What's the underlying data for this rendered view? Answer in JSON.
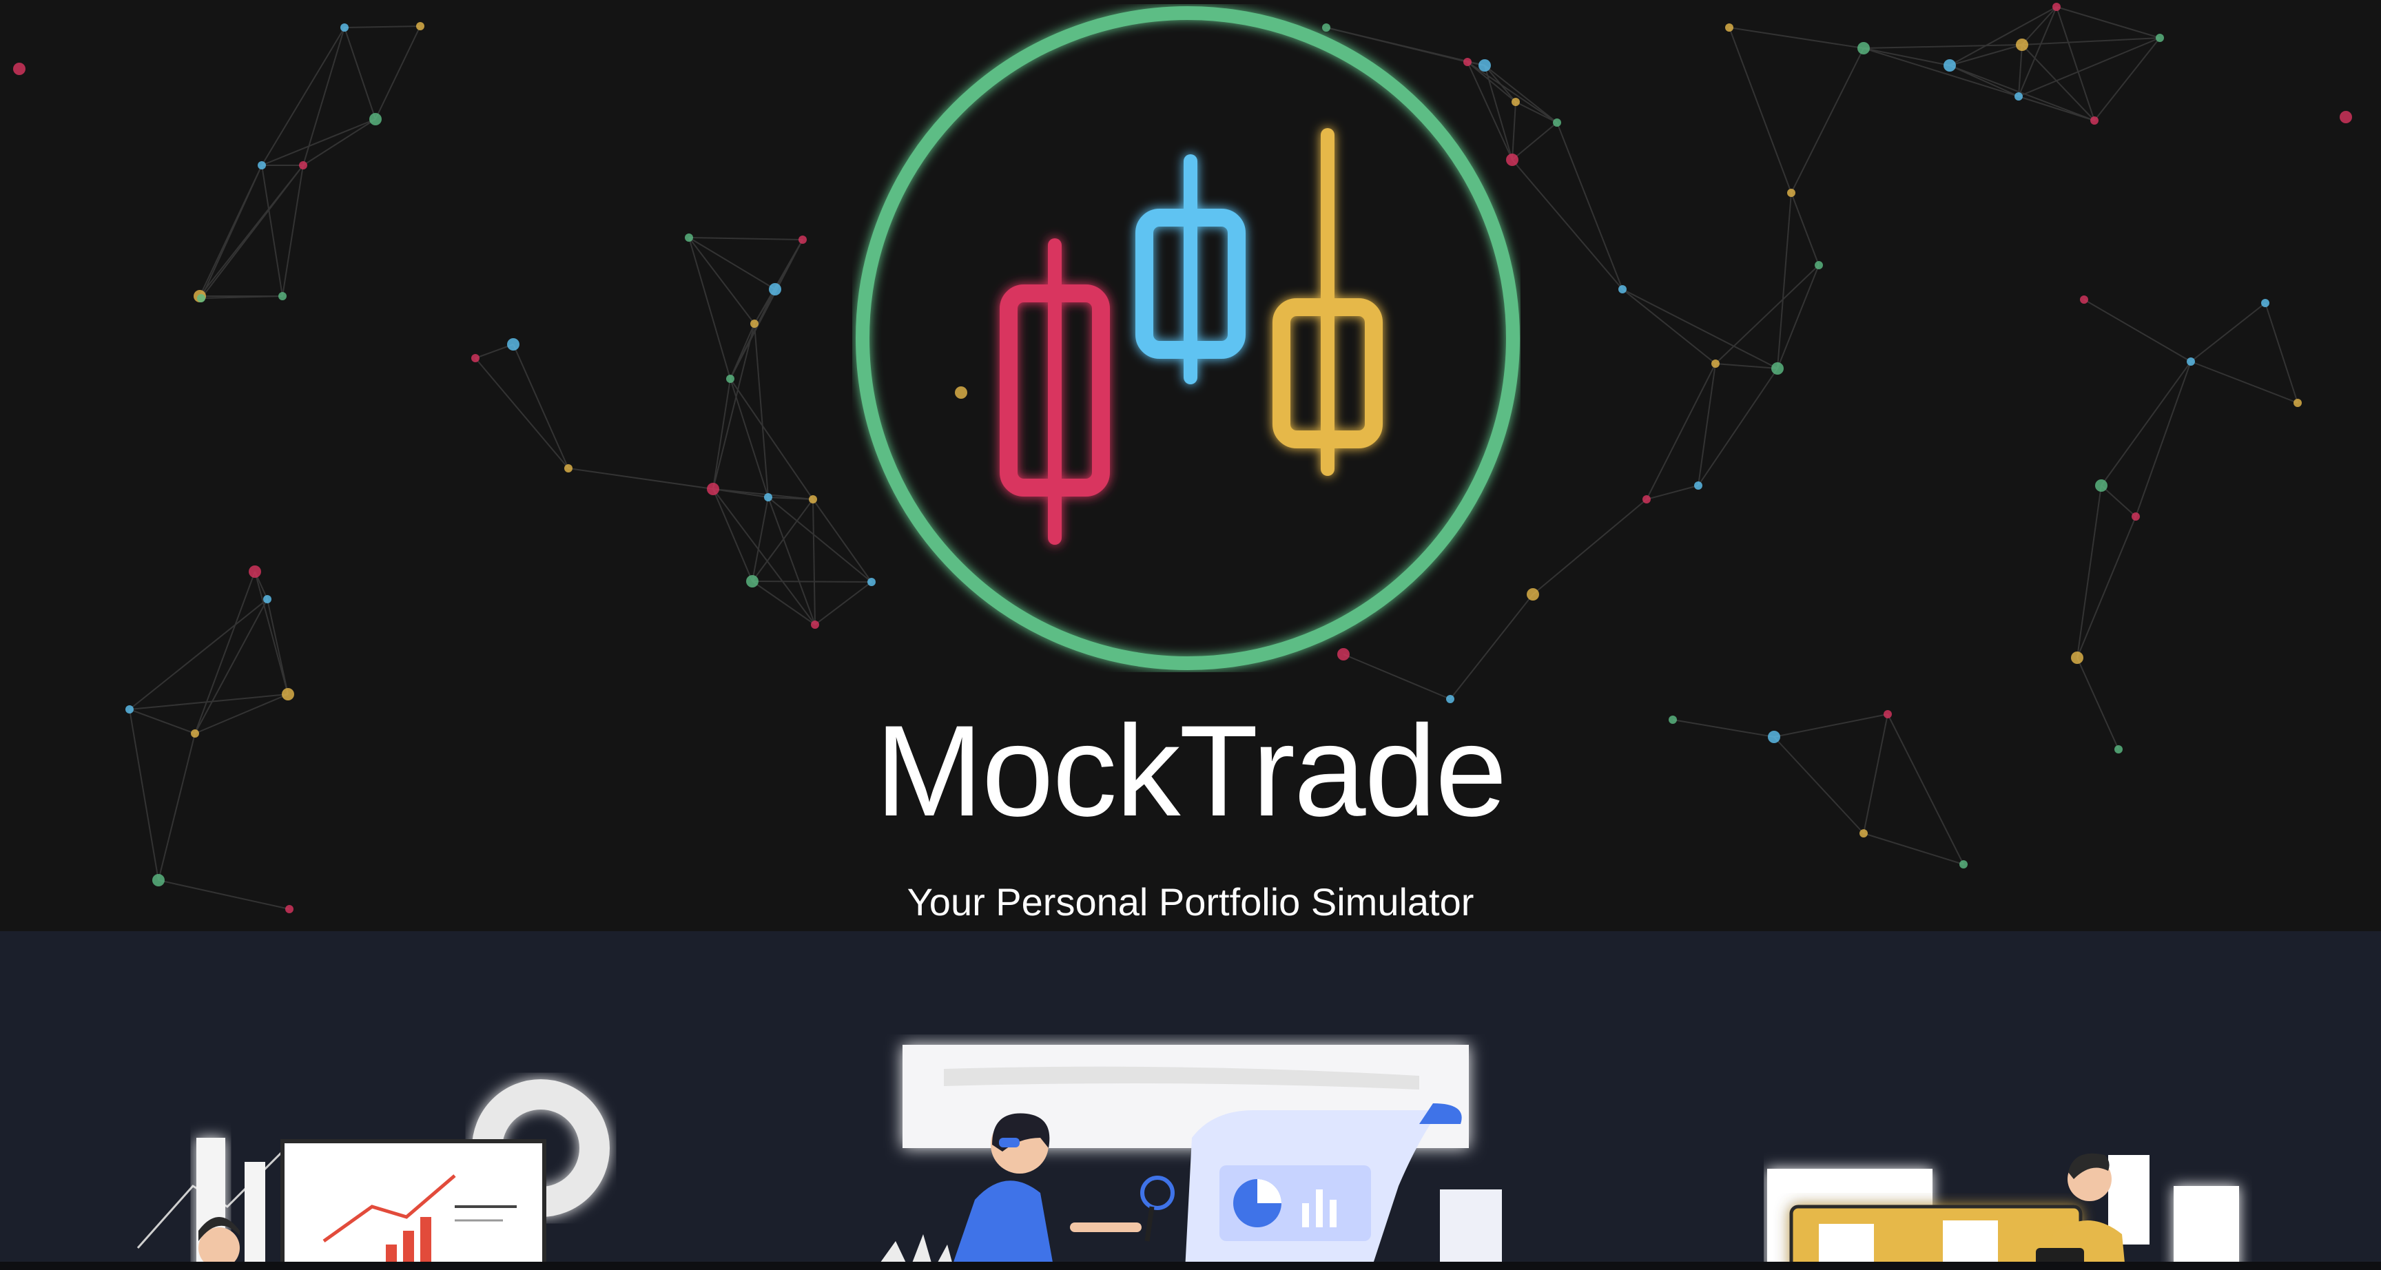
{
  "brand": {
    "title": "MockTrade",
    "subtitle": "Your Personal Portfolio Simulator",
    "logo_icon": "candlestick-chart-icon"
  },
  "colors": {
    "hero_background": "#141414",
    "features_background": "#1b1f2b",
    "logo_ring": "#5dbd85",
    "candle_red": "#d9345f",
    "candle_blue": "#5ec3f2",
    "candle_yellow": "#e6b84a",
    "title_text": "#ffffff"
  },
  "illustrations": [
    {
      "name": "analytics-presentation-illustration"
    },
    {
      "name": "research-report-illustration"
    },
    {
      "name": "portfolio-desk-illustration"
    }
  ]
}
